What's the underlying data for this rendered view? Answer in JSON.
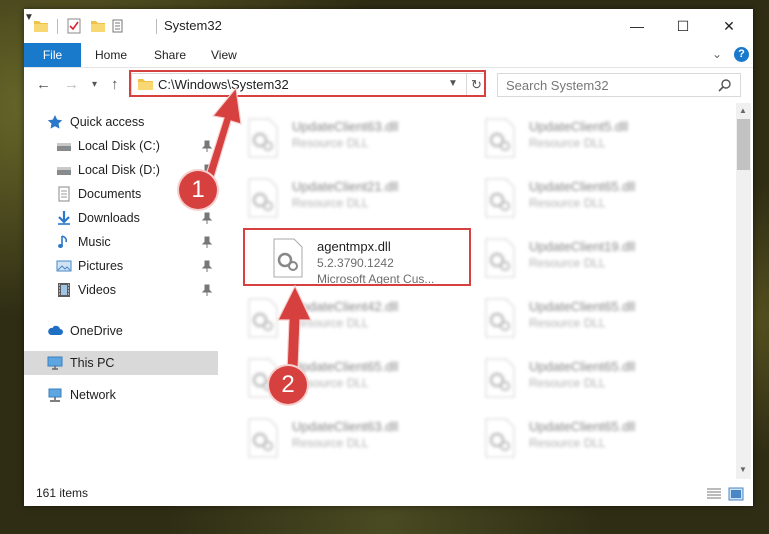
{
  "window": {
    "title": "System32",
    "controls": {
      "minimize": "—",
      "maximize": "☐",
      "close": "✕"
    }
  },
  "ribbon": {
    "tabs": [
      "File",
      "Home",
      "Share",
      "View"
    ],
    "help": "?"
  },
  "address": {
    "path": "C:\\Windows\\System32",
    "search_placeholder": "Search System32"
  },
  "sidebar": {
    "items": [
      {
        "label": "Quick access",
        "icon": "star-icon"
      },
      {
        "label": "Local Disk (C:)",
        "icon": "drive-icon",
        "pinned": true
      },
      {
        "label": "Local Disk (D:)",
        "icon": "drive-icon",
        "pinned": true
      },
      {
        "label": "Documents",
        "icon": "documents-icon",
        "pinned": true
      },
      {
        "label": "Downloads",
        "icon": "download-icon",
        "pinned": true
      },
      {
        "label": "Music",
        "icon": "music-icon",
        "pinned": true
      },
      {
        "label": "Pictures",
        "icon": "pictures-icon",
        "pinned": true
      },
      {
        "label": "Videos",
        "icon": "videos-icon",
        "pinned": true
      },
      {
        "label": "OneDrive",
        "icon": "cloud-icon"
      },
      {
        "label": "This PC",
        "icon": "computer-icon",
        "selected": true
      },
      {
        "label": "Network",
        "icon": "network-icon"
      }
    ]
  },
  "files": [
    {
      "name": "UpdateClient63.dll",
      "desc": "Resource DLL"
    },
    {
      "name": "UpdateClient5.dll",
      "desc": "Resource DLL"
    },
    {
      "name": "UpdateClient21.dll",
      "desc": "Resource DLL"
    },
    {
      "name": "UpdateClient65.dll",
      "desc": "Resource DLL"
    },
    {
      "name": "agentmpx.dll",
      "desc": "5.2.3790.1242",
      "desc2": "Microsoft Agent Cus..."
    },
    {
      "name": "UpdateClient19.dll",
      "desc": "Resource DLL"
    },
    {
      "name": "UpdateClient42.dll",
      "desc": "Resource DLL"
    },
    {
      "name": "UpdateClient65.dll",
      "desc": "Resource DLL"
    },
    {
      "name": "UpdateClient65.dll",
      "desc": "Resource DLL"
    },
    {
      "name": "UpdateClient65.dll",
      "desc": "Resource DLL"
    },
    {
      "name": "UpdateClient63.dll",
      "desc": "Resource DLL"
    },
    {
      "name": "UpdateClient65.dll",
      "desc": "Resource DLL"
    }
  ],
  "status": {
    "count": "161 items"
  },
  "annotations": {
    "step1": "1",
    "step2": "2",
    "color": "#d6403f"
  }
}
